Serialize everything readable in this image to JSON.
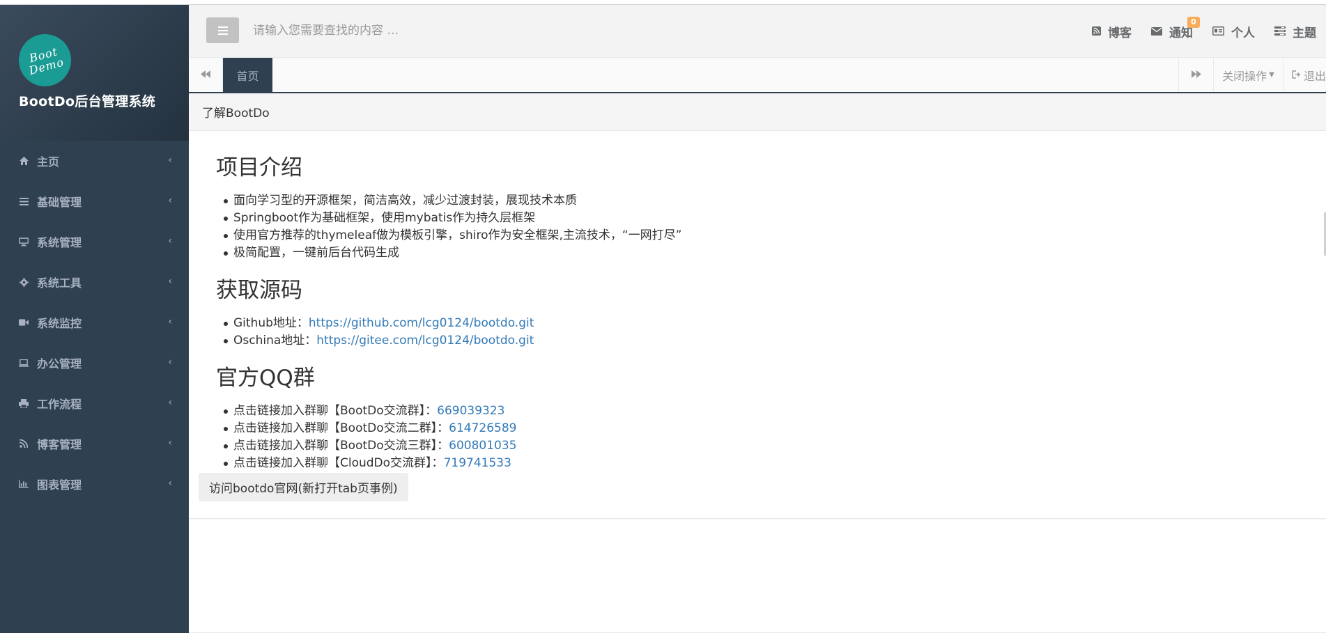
{
  "brand": {
    "logo_line1": "Boot",
    "logo_line2": "Demo",
    "title": "BootDo后台管理系统"
  },
  "sidebar": {
    "items": [
      {
        "label": "主页",
        "icon": "home-icon"
      },
      {
        "label": "基础管理",
        "icon": "list-icon"
      },
      {
        "label": "系统管理",
        "icon": "desktop-icon"
      },
      {
        "label": "系统工具",
        "icon": "gear-icon"
      },
      {
        "label": "系统监控",
        "icon": "video-camera-icon"
      },
      {
        "label": "办公管理",
        "icon": "laptop-icon"
      },
      {
        "label": "工作流程",
        "icon": "print-icon"
      },
      {
        "label": "博客管理",
        "icon": "rss-icon"
      },
      {
        "label": "图表管理",
        "icon": "bar-chart-icon"
      }
    ]
  },
  "topbar": {
    "search_placeholder": "请输入您需要查找的内容 …",
    "links": {
      "blog": "博客",
      "notify": "通知",
      "notify_badge": "0",
      "profile": "个人",
      "theme": "主题"
    }
  },
  "tabs": {
    "home": "首页",
    "close_ops": "关闭操作",
    "logout": "退出"
  },
  "panel": {
    "heading": "了解BootDo",
    "section1": {
      "title": "项目介绍",
      "items": [
        "面向学习型的开源框架，简洁高效，减少过渡封装，展现技术本质",
        "Springboot作为基础框架，使用mybatis作为持久层框架",
        "使用官方推荐的thymeleaf做为模板引擎，shiro作为安全框架,主流技术，“一网打尽”",
        "极简配置，一键前后台代码生成"
      ]
    },
    "section2": {
      "title": "获取源码",
      "github_label": "Github地址：",
      "github_url": "https://github.com/lcg0124/bootdo.git",
      "oschina_label": "Oschina地址：",
      "oschina_url": "https://gitee.com/lcg0124/bootdo.git"
    },
    "section3": {
      "title": "官方QQ群",
      "groups": [
        {
          "label": "点击链接加入群聊【BootDo交流群】：",
          "number": "669039323"
        },
        {
          "label": "点击链接加入群聊【BootDo交流二群】：",
          "number": "614726589"
        },
        {
          "label": "点击链接加入群聊【BootDo交流三群】：",
          "number": "600801035"
        },
        {
          "label": "点击链接加入群聊【CloudDo交流群】：",
          "number": "719741533"
        }
      ]
    },
    "visit_button": "访问bootdo官网(新打开tab页事例)"
  }
}
